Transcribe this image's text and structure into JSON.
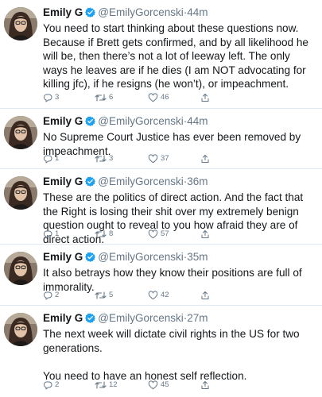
{
  "colors": {
    "verified": "#1da1f2",
    "meta": "#657786",
    "text": "#14171a",
    "divider": "#e1e8ed"
  },
  "icons": [
    "avatar",
    "verified-badge-icon",
    "reply-icon",
    "retweet-icon",
    "like-icon",
    "share-icon"
  ],
  "tweets": [
    {
      "name": "Emily G",
      "handle": "@EmilyGorcenski",
      "sep": "·",
      "time": "44m",
      "text": "You need to start thinking about these questions now. Because if Brett gets confirmed, and by all likelihood he will be, then there’s not a lot of leeway left. The only ways he leaves are if he dies (I am NOT advocating for killing jfc), if he resigns (he won’t), or impeachment.",
      "replies": "3",
      "retweets": "6",
      "likes": "46"
    },
    {
      "name": "Emily G",
      "handle": "@EmilyGorcenski",
      "sep": "·",
      "time": "44m",
      "text": "No Supreme Court Justice has ever been removed by impeachment.",
      "replies": "1",
      "retweets": "3",
      "likes": "37"
    },
    {
      "name": "Emily G",
      "handle": "@EmilyGorcenski",
      "sep": "·",
      "time": "36m",
      "text": "These are the politics of direct action. And the fact that the Right is losing their shit over my extremely benign question ought to reveal to you how afraid they are of direct action.",
      "replies": "1",
      "retweets": "8",
      "likes": "57"
    },
    {
      "name": "Emily G",
      "handle": "@EmilyGorcenski",
      "sep": "·",
      "time": "35m",
      "text": "It also betrays how they know their positions are full of immorality.",
      "replies": "2",
      "retweets": "5",
      "likes": "42"
    },
    {
      "name": "Emily G",
      "handle": "@EmilyGorcenski",
      "sep": "·",
      "time": "27m",
      "text": "The next week will dictate civil rights in the US for two generations.\n\nYou need to have an honest self reflection.",
      "replies": "2",
      "retweets": "12",
      "likes": "45"
    }
  ]
}
